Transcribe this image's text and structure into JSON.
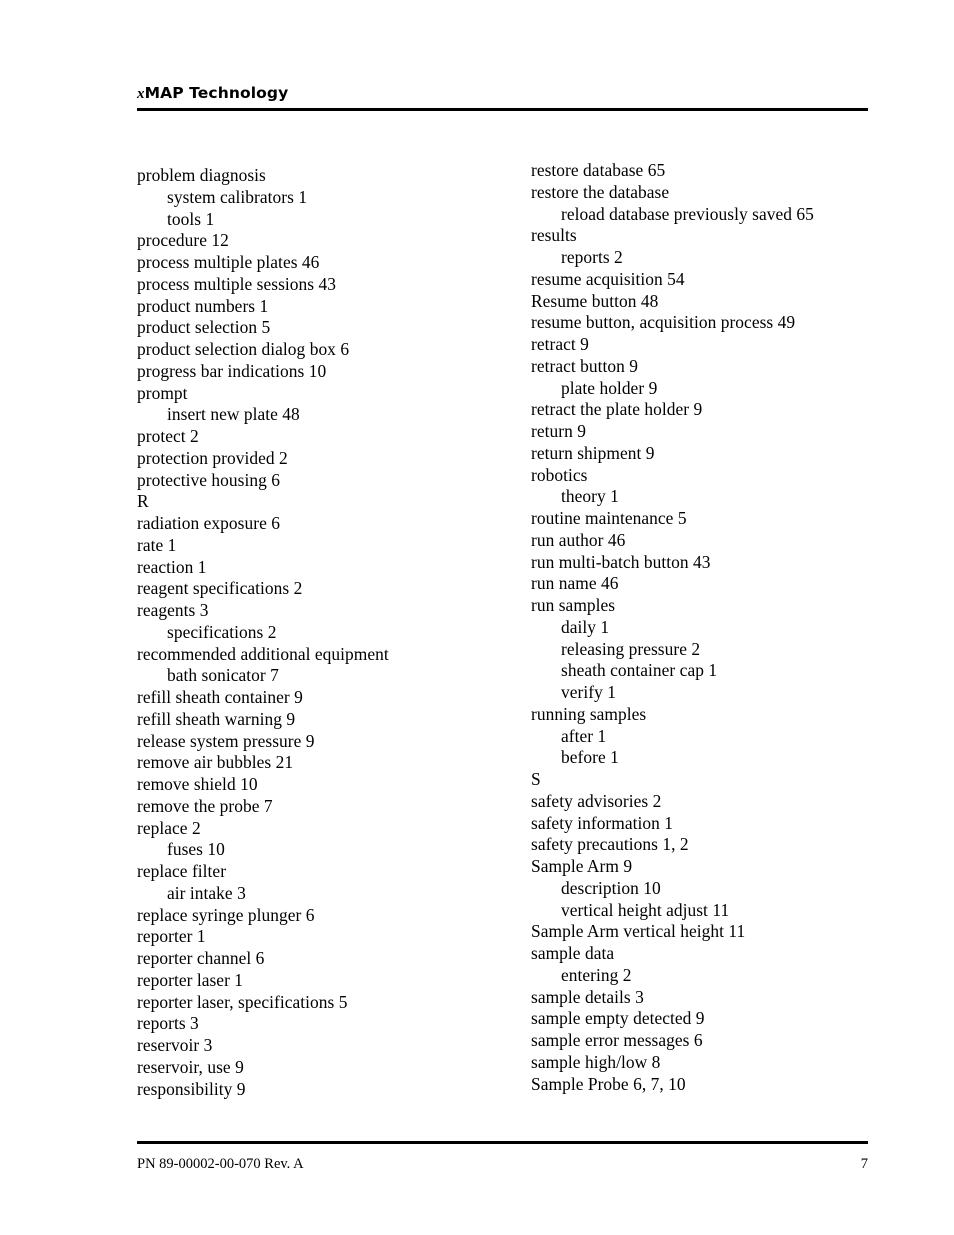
{
  "header": {
    "title_lead": "x",
    "title_rest": "MAP Technology"
  },
  "index": {
    "left_column": [
      {
        "text": "problem diagnosis",
        "level": 1
      },
      {
        "text": "system calibrators 1",
        "level": 2
      },
      {
        "text": "tools 1",
        "level": 2
      },
      {
        "text": "procedure 12",
        "level": 1
      },
      {
        "text": "process multiple plates 46",
        "level": 1
      },
      {
        "text": "process multiple sessions 43",
        "level": 1
      },
      {
        "text": "product numbers 1",
        "level": 1
      },
      {
        "text": "product selection 5",
        "level": 1
      },
      {
        "text": "product selection dialog box 6",
        "level": 1
      },
      {
        "text": "progress bar indications 10",
        "level": 1
      },
      {
        "text": "prompt",
        "level": 1
      },
      {
        "text": "insert new plate 48",
        "level": 2
      },
      {
        "text": "protect 2",
        "level": 1
      },
      {
        "text": "protection provided 2",
        "level": 1
      },
      {
        "text": "protective housing 6",
        "level": 1
      },
      {
        "text": "R",
        "level": 0
      },
      {
        "text": "radiation exposure 6",
        "level": 1
      },
      {
        "text": "rate 1",
        "level": 1
      },
      {
        "text": "reaction 1",
        "level": 1
      },
      {
        "text": "reagent specifications 2",
        "level": 1
      },
      {
        "text": "reagents 3",
        "level": 1
      },
      {
        "text": "specifications 2",
        "level": 2
      },
      {
        "text": "recommended additional equipment",
        "level": 1
      },
      {
        "text": "bath sonicator 7",
        "level": 2
      },
      {
        "text": "refill sheath container 9",
        "level": 1
      },
      {
        "text": "refill sheath warning 9",
        "level": 1
      },
      {
        "text": "release system pressure 9",
        "level": 1
      },
      {
        "text": "remove air bubbles 21",
        "level": 1
      },
      {
        "text": "remove shield 10",
        "level": 1
      },
      {
        "text": "remove the probe 7",
        "level": 1
      },
      {
        "text": "replace 2",
        "level": 1
      },
      {
        "text": "fuses 10",
        "level": 2
      },
      {
        "text": "replace filter",
        "level": 1
      },
      {
        "text": "air intake 3",
        "level": 2
      },
      {
        "text": "replace syringe plunger 6",
        "level": 1
      },
      {
        "text": "reporter 1",
        "level": 1
      },
      {
        "text": "reporter channel 6",
        "level": 1
      },
      {
        "text": "reporter laser 1",
        "level": 1
      },
      {
        "text": "reporter laser, specifications 5",
        "level": 1
      },
      {
        "text": "reports 3",
        "level": 1
      },
      {
        "text": "reservoir 3",
        "level": 1
      },
      {
        "text": "reservoir, use 9",
        "level": 1
      },
      {
        "text": "responsibility 9",
        "level": 1
      }
    ],
    "right_column": [
      {
        "text": "restore database 65",
        "level": 1
      },
      {
        "text": "restore the database",
        "level": 1
      },
      {
        "text": "reload database previously saved 65",
        "level": 2
      },
      {
        "text": "results",
        "level": 1
      },
      {
        "text": "reports 2",
        "level": 2
      },
      {
        "text": "resume acquisition 54",
        "level": 1
      },
      {
        "text": "Resume button 48",
        "level": 1
      },
      {
        "text": "resume button, acquisition process 49",
        "level": 1
      },
      {
        "text": "retract 9",
        "level": 1
      },
      {
        "text": "retract button 9",
        "level": 1
      },
      {
        "text": "plate holder 9",
        "level": 2
      },
      {
        "text": "retract the plate holder 9",
        "level": 1
      },
      {
        "text": "return 9",
        "level": 1
      },
      {
        "text": "return shipment 9",
        "level": 1
      },
      {
        "text": "robotics",
        "level": 1
      },
      {
        "text": "theory 1",
        "level": 2
      },
      {
        "text": "routine maintenance 5",
        "level": 1
      },
      {
        "text": "run author 46",
        "level": 1
      },
      {
        "text": "run multi-batch button 43",
        "level": 1
      },
      {
        "text": "run name 46",
        "level": 1
      },
      {
        "text": "run samples",
        "level": 1
      },
      {
        "text": "daily 1",
        "level": 2
      },
      {
        "text": "releasing pressure 2",
        "level": 2
      },
      {
        "text": "sheath container cap 1",
        "level": 2
      },
      {
        "text": "verify 1",
        "level": 2
      },
      {
        "text": "running samples",
        "level": 1
      },
      {
        "text": "after 1",
        "level": 2
      },
      {
        "text": "before 1",
        "level": 2
      },
      {
        "text": "S",
        "level": 0
      },
      {
        "text": "safety advisories 2",
        "level": 1
      },
      {
        "text": "safety information 1",
        "level": 1
      },
      {
        "text": "safety precautions 1, 2",
        "level": 1
      },
      {
        "text": "Sample Arm 9",
        "level": 1
      },
      {
        "text": "description 10",
        "level": 2
      },
      {
        "text": "vertical height adjust 11",
        "level": 2
      },
      {
        "text": "Sample Arm vertical height 11",
        "level": 1
      },
      {
        "text": "sample data",
        "level": 1
      },
      {
        "text": "entering 2",
        "level": 2
      },
      {
        "text": "sample details 3",
        "level": 1
      },
      {
        "text": "sample empty detected 9",
        "level": 1
      },
      {
        "text": "sample error messages 6",
        "level": 1
      },
      {
        "text": "sample high/low 8",
        "level": 1
      },
      {
        "text": "Sample Probe 6, 7, 10",
        "level": 1
      }
    ]
  },
  "footer": {
    "part_number": "PN 89-00002-00-070 Rev. A",
    "page_number": "7"
  }
}
